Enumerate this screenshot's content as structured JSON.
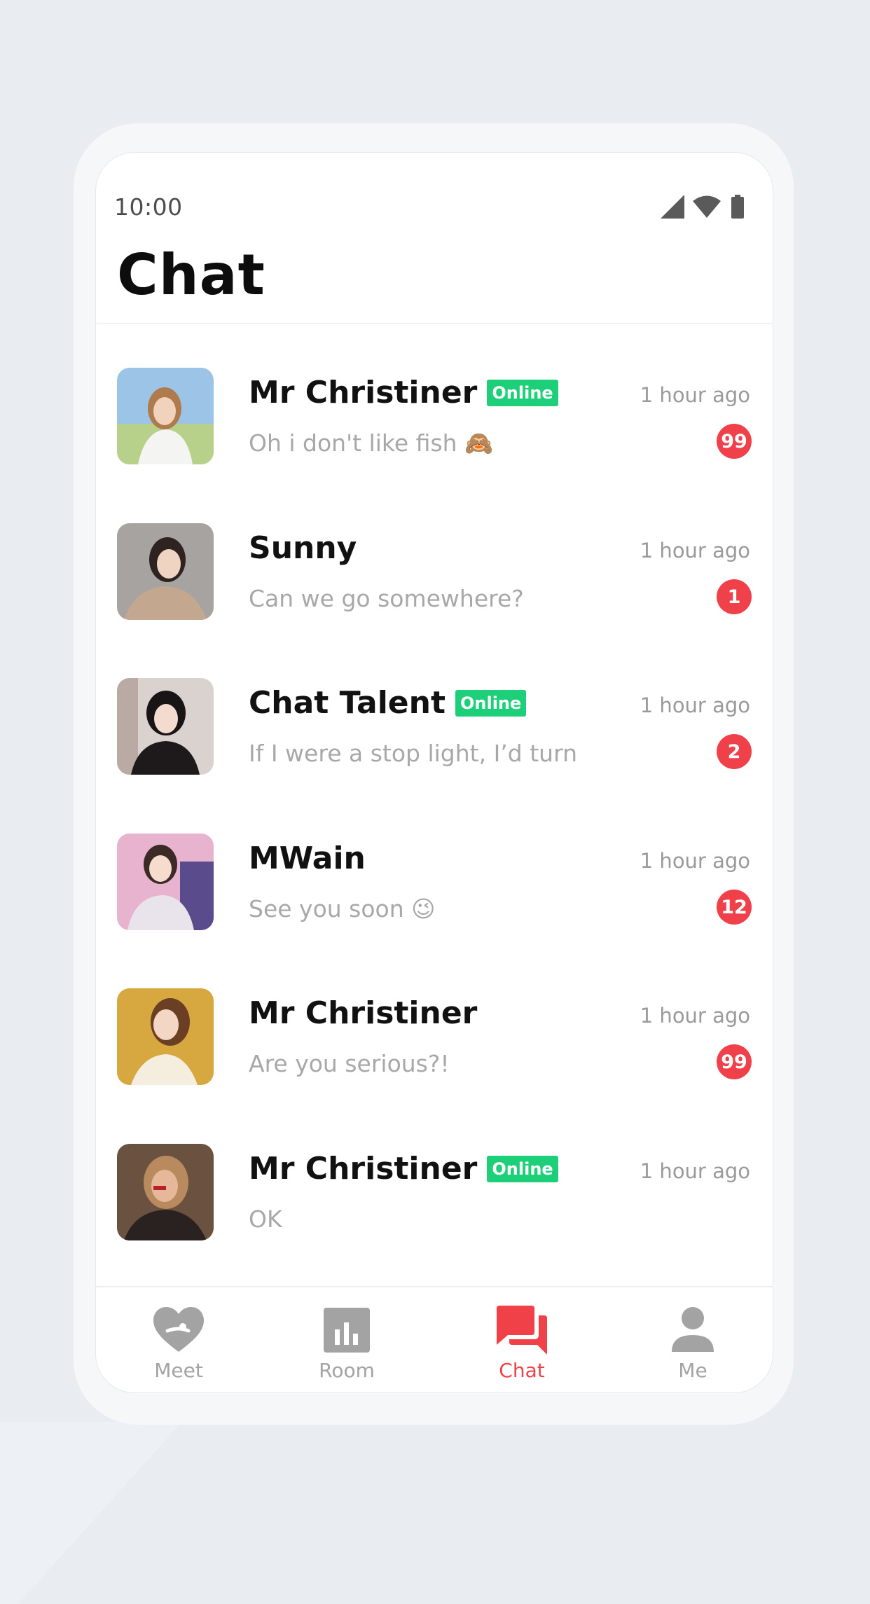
{
  "colors": {
    "accent": "#f04048",
    "online": "#1ecf7a",
    "badge": "#f0404a",
    "inactive_tab": "#a3a3a3"
  },
  "status_bar": {
    "time": "10:00",
    "icons": [
      "signal-icon",
      "wifi-icon",
      "battery-icon"
    ]
  },
  "header": {
    "title": "Chat"
  },
  "chats": [
    {
      "name": "Mr Christiner",
      "online_label": "Online",
      "time": "1 hour ago",
      "message": "Oh i don't like fish 🙈",
      "unread": "99"
    },
    {
      "name": "Sunny",
      "online_label": "",
      "time": "1 hour ago",
      "message": "Can we go somewhere?",
      "unread": "1"
    },
    {
      "name": "Chat Talent",
      "online_label": "Online",
      "time": "1 hour ago",
      "message": "If I were a stop light, I’d turn",
      "unread": "2"
    },
    {
      "name": "MWain",
      "online_label": "",
      "time": "1 hour ago",
      "message": "See you soon 😉",
      "unread": "12"
    },
    {
      "name": "Mr Christiner",
      "online_label": "",
      "time": "1 hour ago",
      "message": "Are you serious?!",
      "unread": "99"
    },
    {
      "name": "Mr Christiner",
      "online_label": "Online",
      "time": "1 hour ago",
      "message": "OK",
      "unread": ""
    }
  ],
  "tabs": [
    {
      "label": "Meet",
      "icon": "heart-icon",
      "active": false
    },
    {
      "label": "Room",
      "icon": "chart-icon",
      "active": false
    },
    {
      "label": "Chat",
      "icon": "chat-icon",
      "active": true
    },
    {
      "label": "Me",
      "icon": "person-icon",
      "active": false
    }
  ]
}
